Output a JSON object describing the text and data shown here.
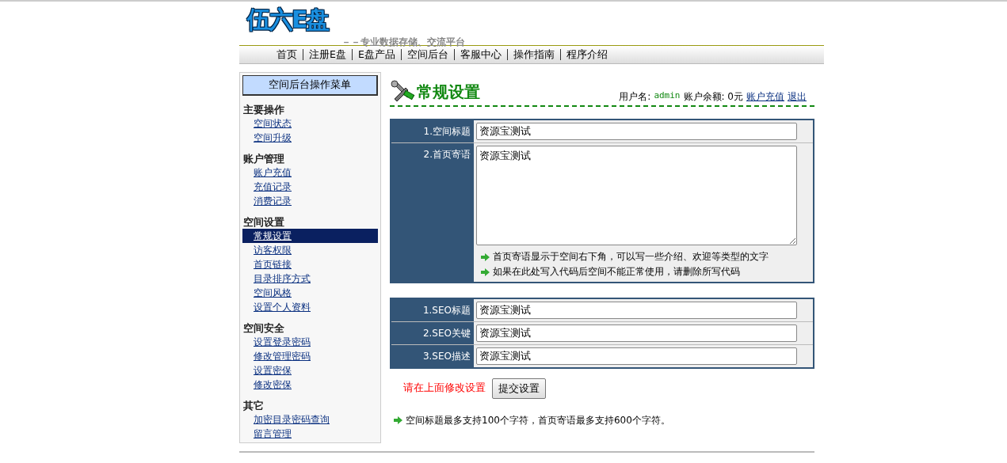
{
  "header": {
    "logo": "伍六E盘",
    "tagline": "－－专业数据存储、交流平台"
  },
  "nav": [
    "首页",
    "注册E盘",
    "E盘产品",
    "空间后台",
    "客服中心",
    "操作指南",
    "程序介绍"
  ],
  "sidebar": {
    "title": "空间后台操作菜单",
    "groups": [
      {
        "heading": "主要操作",
        "items": [
          {
            "label": "空间状态",
            "selected": false
          },
          {
            "label": "空间升级",
            "selected": false
          }
        ]
      },
      {
        "heading": "账户管理",
        "items": [
          {
            "label": "账户充值",
            "selected": false
          },
          {
            "label": "充值记录",
            "selected": false
          },
          {
            "label": "消费记录",
            "selected": false
          }
        ]
      },
      {
        "heading": "空间设置",
        "items": [
          {
            "label": "常规设置",
            "selected": true
          },
          {
            "label": "访客权限",
            "selected": false
          },
          {
            "label": "首页链接",
            "selected": false
          },
          {
            "label": "目录排序方式",
            "selected": false
          },
          {
            "label": "空间风格",
            "selected": false
          },
          {
            "label": "设置个人资料",
            "selected": false
          }
        ]
      },
      {
        "heading": "空间安全",
        "items": [
          {
            "label": "设置登录密码",
            "selected": false
          },
          {
            "label": "修改管理密码",
            "selected": false
          },
          {
            "label": "设置密保",
            "selected": false
          },
          {
            "label": "修改密保",
            "selected": false
          }
        ]
      },
      {
        "heading": "其它",
        "items": [
          {
            "label": "加密目录密码查询",
            "selected": false
          },
          {
            "label": "留言管理",
            "selected": false
          }
        ]
      }
    ]
  },
  "main": {
    "title": "常规设置",
    "user_label": "用户名:",
    "username": "admin",
    "balance": "账户余额: 0元",
    "links": [
      "账户充值",
      "退出"
    ],
    "basic_fields": [
      {
        "label": "1.空间标题",
        "kind": "input",
        "value": "资源宝测试"
      },
      {
        "label": "2.首页寄语",
        "kind": "textarea",
        "value": "资源宝测试",
        "hints": [
          "首页寄语显示于空间右下角，可以写一些介绍、欢迎等类型的文字",
          "如果在此处写入代码后空间不能正常使用，请删除所写代码"
        ]
      }
    ],
    "seo_fields": [
      {
        "label": "1.SEO标题",
        "kind": "input",
        "value": "资源宝测试"
      },
      {
        "label": "2.SEO关键",
        "kind": "input",
        "value": "资源宝测试"
      },
      {
        "label": "3.SEO描述",
        "kind": "input",
        "value": "资源宝测试"
      }
    ],
    "prompt": "请在上面修改设置",
    "submit": "提交设置",
    "note": "空间标题最多支持100个字符，首页寄语最多支持600个字符。"
  }
}
